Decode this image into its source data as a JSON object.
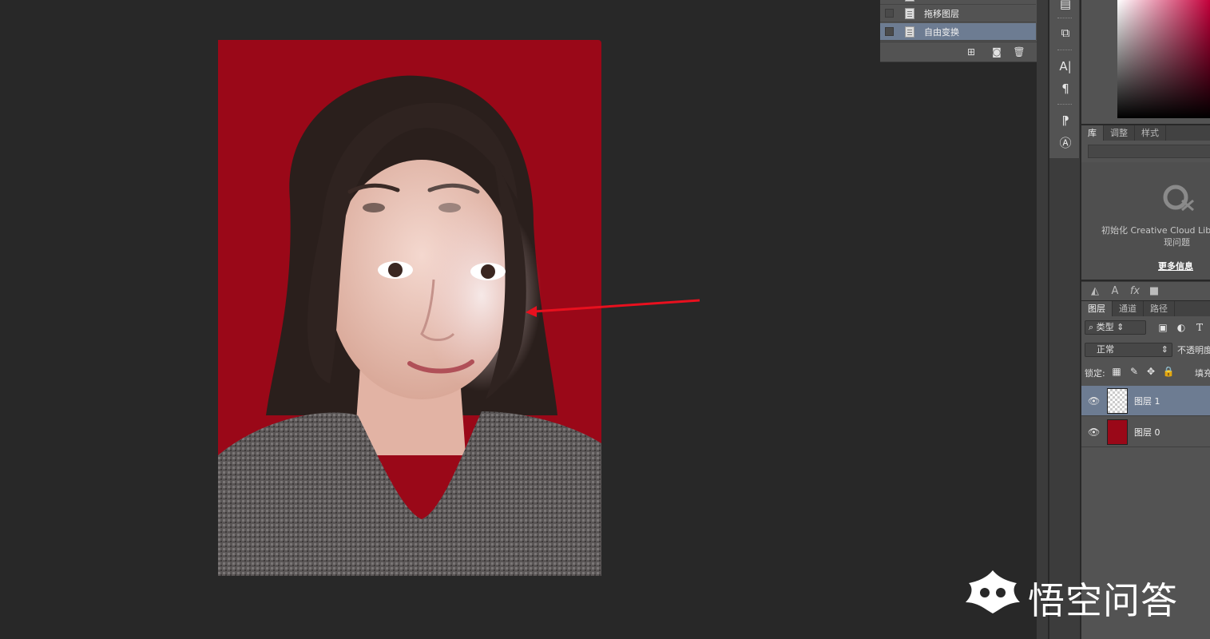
{
  "history": {
    "items": [
      {
        "label": "",
        "selected": false
      },
      {
        "label": "拖移图层",
        "selected": false
      },
      {
        "label": "自由变换",
        "selected": true
      }
    ],
    "icons": [
      "new-document-icon",
      "camera-icon",
      "trash-icon"
    ]
  },
  "tools": {
    "icons": [
      "swatch-icon",
      "transform-icon",
      "character-icon",
      "paragraph-icon",
      "paragraph-style-icon",
      "character-style-icon"
    ],
    "character_glyph": "A|",
    "paragraph_glyph": "¶"
  },
  "library": {
    "tabs": [
      "库",
      "调整",
      "样式"
    ],
    "message_line1": "初始化 Creative Cloud Libr",
    "message_line2": "现问题",
    "more_link": "更多信息"
  },
  "style_bar": {
    "glyph_a": "A",
    "glyph_fx": "fx"
  },
  "layers": {
    "tabs": [
      "图层",
      "通道",
      "路径"
    ],
    "filter_label": "类型",
    "filter_icon_text": "T",
    "blend_mode": "正常",
    "opacity_label": "不透明度",
    "lock_label": "锁定:",
    "fill_label": "填充",
    "items": [
      {
        "name": "图层 1",
        "selected": true,
        "thumb": "transparent"
      },
      {
        "name": "图层 0",
        "selected": false,
        "thumb": "photo"
      }
    ]
  },
  "watermark": {
    "text": "悟空问答"
  },
  "colors": {
    "canvas_bg": "#9a0818",
    "app_bg": "#282828",
    "panel_bg": "#535353",
    "selection": "#6d7c92",
    "arrow": "#e8101e"
  }
}
